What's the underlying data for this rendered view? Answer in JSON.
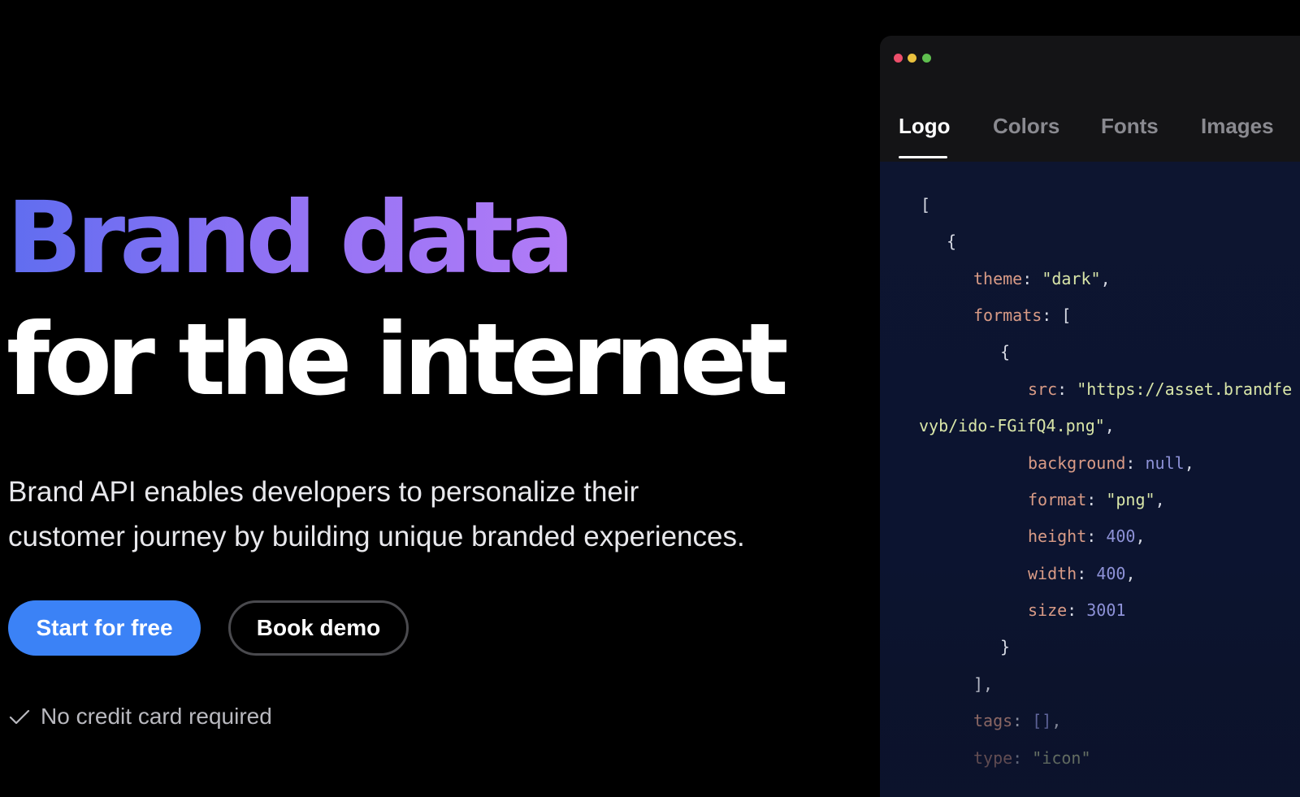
{
  "hero": {
    "headline_line1": "Brand data",
    "headline_line2": "for the internet",
    "subtext_line1": "Brand API enables developers to personalize their",
    "subtext_line2": "customer journey by building unique branded experiences.",
    "primary_button": "Start for free",
    "secondary_button": "Book demo",
    "note": "No credit card required"
  },
  "window": {
    "tabs": [
      {
        "label": "Logo",
        "active": true
      },
      {
        "label": "Colors",
        "active": false
      },
      {
        "label": "Fonts",
        "active": false
      },
      {
        "label": "Images",
        "active": false
      }
    ],
    "code": {
      "open_bracket": "[",
      "open_brace": "{",
      "theme_key": "theme",
      "theme_value": "\"dark\"",
      "formats_key": "formats",
      "formats_open": "[",
      "inner_open_brace": "{",
      "src_key": "src",
      "src_value": "\"https://asset.brandfe",
      "src_value_cont": "vyb/ido-FGifQ4.png\"",
      "background_key": "background",
      "background_value": "null",
      "format_key": "format",
      "format_value": "\"png\"",
      "height_key": "height",
      "height_value": "400",
      "width_key": "width",
      "width_value": "400",
      "size_key": "size",
      "size_value": "3001",
      "inner_close_brace": "}",
      "formats_close": "],",
      "tags_key": "tags",
      "tags_value": "[]",
      "type_key": "type",
      "type_value": "\"icon\""
    }
  },
  "colors": {
    "accent_blue": "#3b82f6",
    "dot_red": "#ed4f6b",
    "dot_yellow": "#e9c13e",
    "dot_green": "#5fbf4f"
  }
}
